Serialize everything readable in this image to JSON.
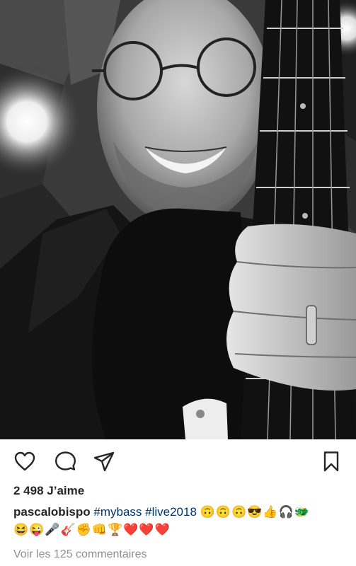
{
  "post": {
    "likes_text": "2 498 J’aime",
    "username": "pascalobispo",
    "hashtag_1": "#mybass",
    "hashtag_2": "#live2018",
    "caption_emojis_line1": "🙃🙃🙃😎👍🎧🐲",
    "caption_emojis_line2": "😆😜🎤🎸✊👊🏆❤️❤️❤️",
    "view_comments": "Voir les 125 commentaires"
  },
  "icons": {
    "like": "heart-icon",
    "comment": "comment-icon",
    "share": "paper-plane-icon",
    "save": "bookmark-icon"
  },
  "colors": {
    "text": "#262626",
    "hashtag": "#003569",
    "muted": "#8e8e8e",
    "background": "#ffffff"
  }
}
